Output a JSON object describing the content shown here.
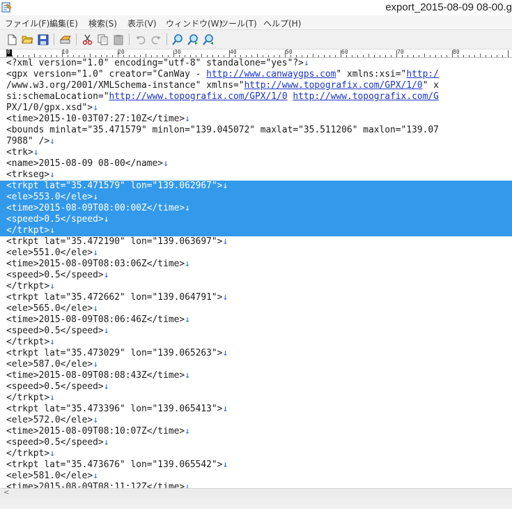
{
  "window": {
    "title": "export_2015-08-09 08-00.g"
  },
  "menu": [
    "ファイル(F)",
    "編集(E)",
    "検索(S)",
    "表示(V)",
    "ウィンドウ(W)",
    "ツール(T)",
    "ヘルプ(H)"
  ],
  "toolbar": {
    "icons": [
      "new-file-icon",
      "open-folder-icon",
      "save-icon",
      "print-icon",
      "cut-icon",
      "copy-icon",
      "paste-icon",
      "undo-icon",
      "redo-icon",
      "find-icon",
      "find-next-icon",
      "find-previous-icon"
    ]
  },
  "ruler": {
    "labels": [
      "0",
      "10",
      "20",
      "30",
      "40",
      "50",
      "60",
      "70",
      "80"
    ]
  },
  "editor": {
    "newline_mark": "↓",
    "lines": [
      {
        "text": "<?xml version=\"1.0\" encoding=\"utf-8\" standalone=\"yes\"?>",
        "nl": true
      },
      {
        "text": "<gpx version=\"1.0\" creator=\"CanWay - ",
        "link": "http://www.canwaygps.com",
        "after": "\" xmlns:xsi=\"",
        "link2": "http:/",
        "nl": false
      },
      {
        "text": "/www.w3.org/2001/XMLSchema-instance\" xmlns=\"",
        "link": "http://www.topografix.com/GPX/1/0",
        "after": "\" x",
        "nl": false
      },
      {
        "text": "si:schemaLocation=\"",
        "link": "http://www.topografix.com/GPX/1/0",
        "after": " ",
        "link2": "http://www.topografix.com/G",
        "nl": false
      },
      {
        "text": "PX/1/0/gpx.xsd\">",
        "nl": true
      },
      {
        "text": "<time>2015-10-03T07:27:10Z</time>",
        "nl": true
      },
      {
        "text": "<bounds minlat=\"35.471579\" minlon=\"139.045072\" maxlat=\"35.511206\" maxlon=\"139.07",
        "nl": false
      },
      {
        "text": "7988\" />",
        "nl": true
      },
      {
        "text": "<trk>",
        "nl": true
      },
      {
        "text": "<name>2015-08-09 08-00</name>",
        "nl": true
      },
      {
        "text": "<trkseg>",
        "nl": true
      },
      {
        "text": "<trkpt lat=\"35.471579\" lon=\"139.062967\">",
        "nl": true,
        "selected": true
      },
      {
        "text": "<ele>553.0</ele>",
        "nl": true,
        "selected": true
      },
      {
        "text": "<time>2015-08-09T08:00:00Z</time>",
        "nl": true,
        "selected": true
      },
      {
        "text": "<speed>0.5</speed>",
        "nl": true,
        "selected": true
      },
      {
        "text": "</trkpt>",
        "nl": true,
        "selected": true
      },
      {
        "text": "<trkpt lat=\"35.472190\" lon=\"139.063697\">",
        "nl": true
      },
      {
        "text": "<ele>551.0</ele>",
        "nl": true
      },
      {
        "text": "<time>2015-08-09T08:03:06Z</time>",
        "nl": true
      },
      {
        "text": "<speed>0.5</speed>",
        "nl": true
      },
      {
        "text": "</trkpt>",
        "nl": true
      },
      {
        "text": "<trkpt lat=\"35.472662\" lon=\"139.064791\">",
        "nl": true
      },
      {
        "text": "<ele>565.0</ele>",
        "nl": true
      },
      {
        "text": "<time>2015-08-09T08:06:46Z</time>",
        "nl": true
      },
      {
        "text": "<speed>0.5</speed>",
        "nl": true
      },
      {
        "text": "</trkpt>",
        "nl": true
      },
      {
        "text": "<trkpt lat=\"35.473029\" lon=\"139.065263\">",
        "nl": true
      },
      {
        "text": "<ele>587.0</ele>",
        "nl": true
      },
      {
        "text": "<time>2015-08-09T08:08:43Z</time>",
        "nl": true
      },
      {
        "text": "<speed>0.5</speed>",
        "nl": true
      },
      {
        "text": "</trkpt>",
        "nl": true
      },
      {
        "text": "<trkpt lat=\"35.473396\" lon=\"139.065413\">",
        "nl": true
      },
      {
        "text": "<ele>572.0</ele>",
        "nl": true
      },
      {
        "text": "<time>2015-08-09T08:10:07Z</time>",
        "nl": true
      },
      {
        "text": "<speed>0.5</speed>",
        "nl": true
      },
      {
        "text": "</trkpt>",
        "nl": true
      },
      {
        "text": "<trkpt lat=\"35.473676\" lon=\"139.065542\">",
        "nl": true
      },
      {
        "text": "<ele>581.0</ele>",
        "nl": true
      },
      {
        "text": "<time>2015-08-09T08:11:12Z</time>",
        "nl": true
      }
    ]
  },
  "colors": {
    "selection": "#3399ea",
    "link": "#1a34c8",
    "newline": "#2a5fd8"
  }
}
